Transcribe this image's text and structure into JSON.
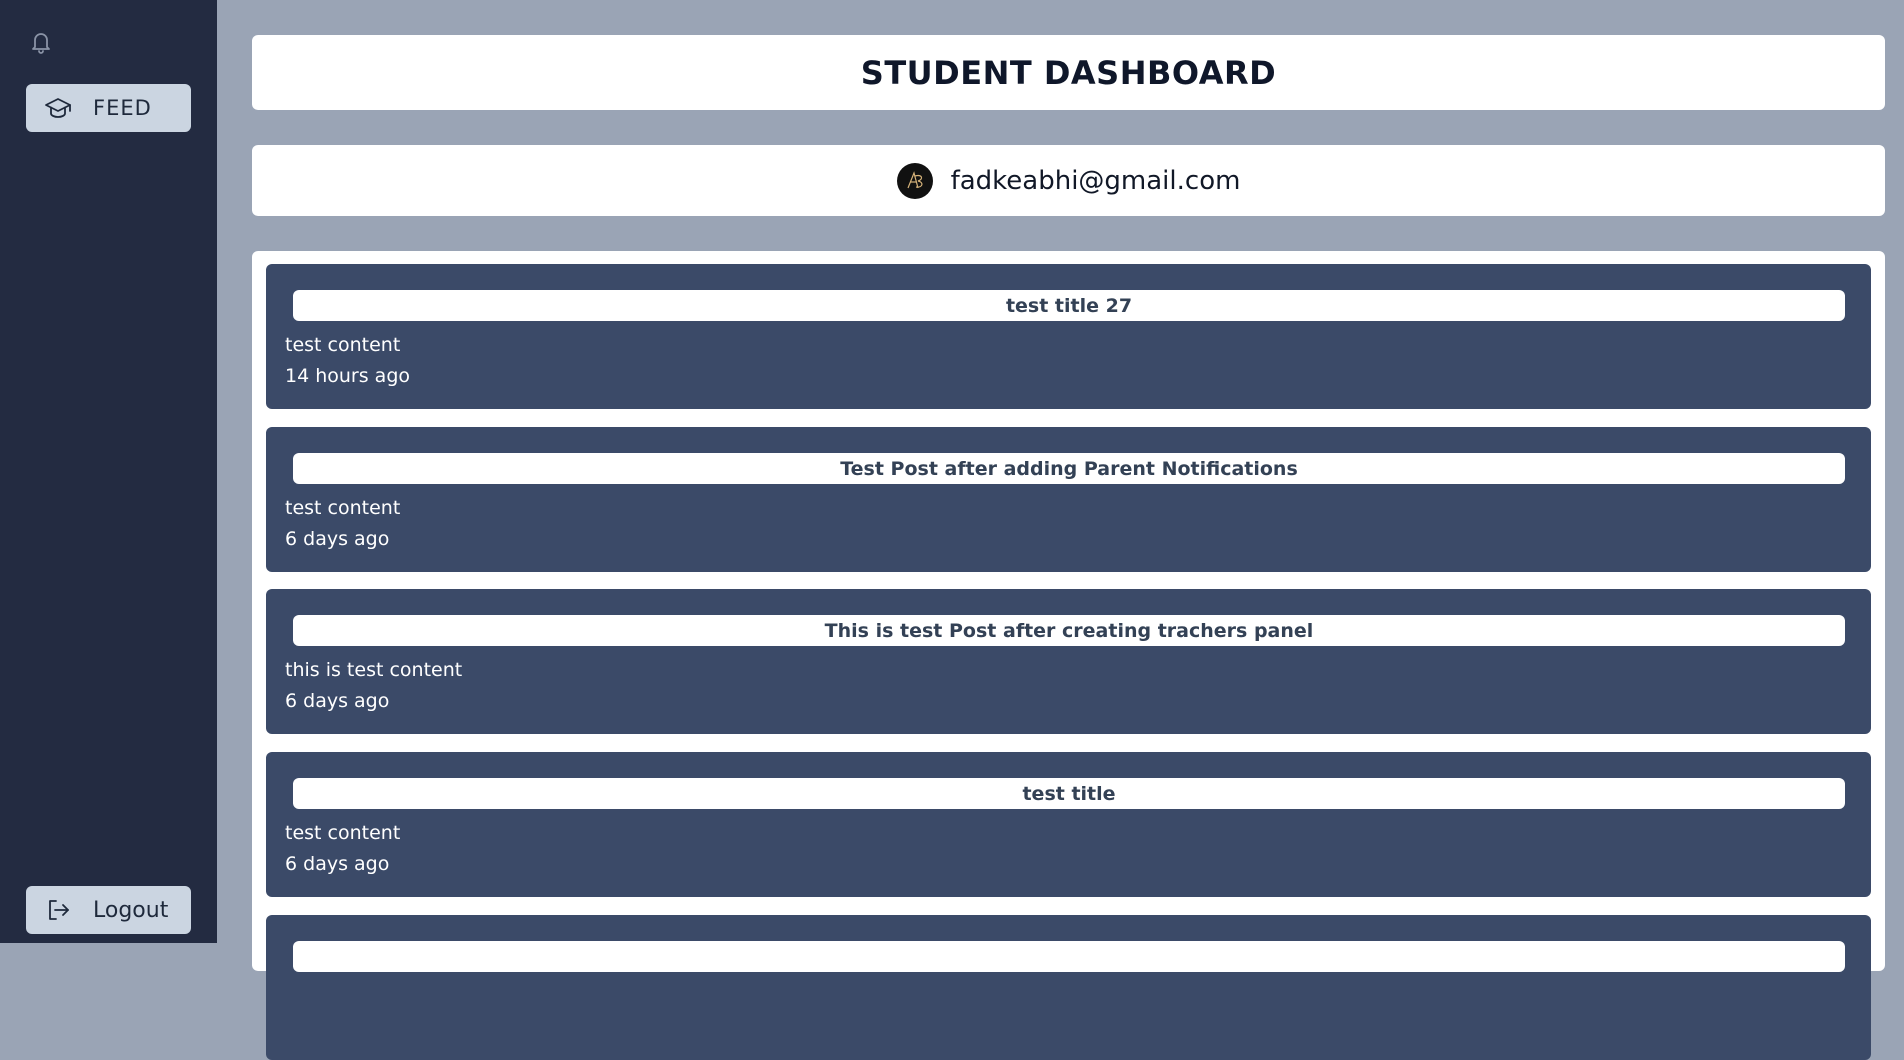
{
  "sidebar": {
    "feed_label": "FEED",
    "logout_label": "Logout"
  },
  "header": {
    "title": "STUDENT DASHBOARD"
  },
  "user": {
    "email": "fadkeabhi@gmail.com"
  },
  "posts": [
    {
      "title": "test title 27",
      "content": "test content",
      "time": "14 hours ago"
    },
    {
      "title": "Test Post after adding Parent Notifications",
      "content": "test content",
      "time": "6 days ago"
    },
    {
      "title": "This is test Post after creating trachers panel",
      "content": "this is test content",
      "time": "6 days ago"
    },
    {
      "title": "test title",
      "content": "test content",
      "time": "6 days ago"
    },
    {
      "title": "",
      "content": "",
      "time": ""
    }
  ],
  "colors": {
    "sidebar_bg": "#232b41",
    "page_bg": "#9aa4b5",
    "post_bg": "#3b4a68",
    "nav_button_bg": "#cbd5e1"
  }
}
